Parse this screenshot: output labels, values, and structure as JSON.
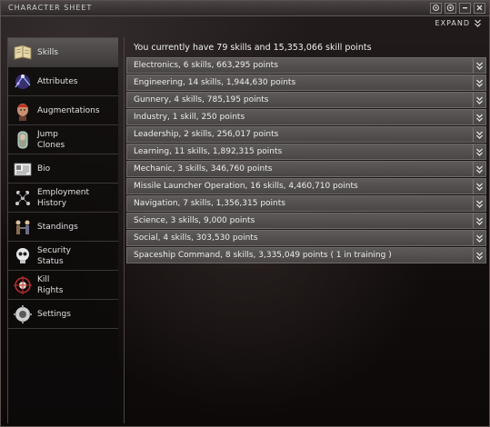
{
  "window": {
    "title": "CHARACTER SHEET",
    "expand_label": "EXPAND",
    "buttons": [
      "settings",
      "help",
      "minimize",
      "close"
    ]
  },
  "sidebar": {
    "items": [
      {
        "label": "Skills",
        "icon": "book-icon",
        "active": true
      },
      {
        "label": "Attributes",
        "icon": "attributes-icon",
        "active": false
      },
      {
        "label": "Augmentations",
        "icon": "augmentations-icon",
        "active": false
      },
      {
        "label": "Jump\nClones",
        "icon": "jump-clones-icon",
        "active": false
      },
      {
        "label": "Bio",
        "icon": "bio-icon",
        "active": false
      },
      {
        "label": "Employment\nHistory",
        "icon": "employment-icon",
        "active": false
      },
      {
        "label": "Standings",
        "icon": "standings-icon",
        "active": false
      },
      {
        "label": "Security\nStatus",
        "icon": "security-icon",
        "active": false
      },
      {
        "label": "Kill\nRights",
        "icon": "kill-rights-icon",
        "active": false
      },
      {
        "label": "Settings",
        "icon": "settings-icon",
        "active": false
      }
    ]
  },
  "main": {
    "summary": "You currently have 79 skills and 15,353,066 skill points",
    "skill_groups": [
      "Electronics, 6 skills, 663,295 points",
      "Engineering, 14 skills, 1,944,630 points",
      "Gunnery, 4 skills, 785,195 points",
      "Industry, 1 skill, 250 points",
      "Leadership, 2 skills, 256,017 points",
      "Learning, 11 skills, 1,892,315 points",
      "Mechanic, 3 skills, 346,760 points",
      "Missile Launcher Operation, 16 skills, 4,460,710 points",
      "Navigation, 7 skills, 1,356,315 points",
      "Science, 3 skills, 9,000 points",
      "Social, 4 skills, 303,530 points",
      "Spaceship Command, 8 skills, 3,335,049 points ( 1 in training )"
    ]
  }
}
